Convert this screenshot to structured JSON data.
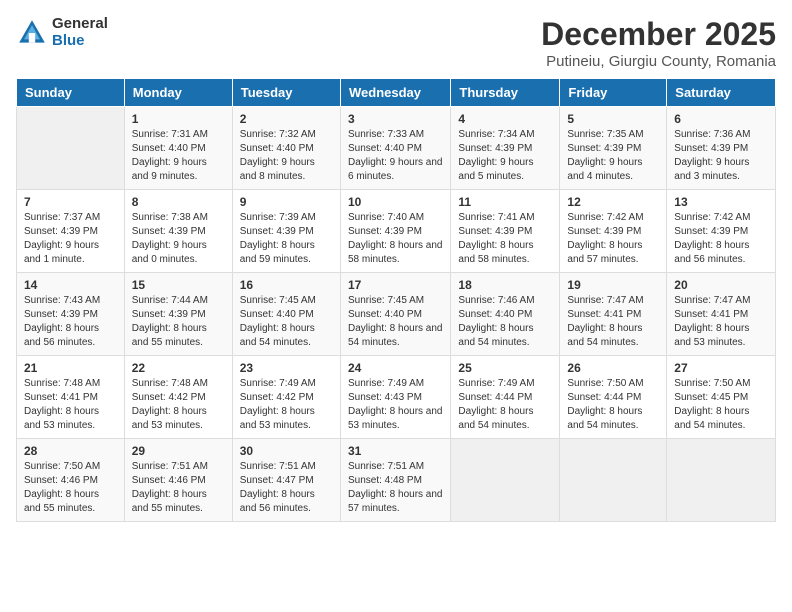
{
  "logo": {
    "general": "General",
    "blue": "Blue"
  },
  "title": "December 2025",
  "subtitle": "Putineiu, Giurgiu County, Romania",
  "days_header": [
    "Sunday",
    "Monday",
    "Tuesday",
    "Wednesday",
    "Thursday",
    "Friday",
    "Saturday"
  ],
  "weeks": [
    [
      {
        "day": "",
        "sunrise": "",
        "sunset": "",
        "daylight": ""
      },
      {
        "day": "1",
        "sunrise": "Sunrise: 7:31 AM",
        "sunset": "Sunset: 4:40 PM",
        "daylight": "Daylight: 9 hours and 9 minutes."
      },
      {
        "day": "2",
        "sunrise": "Sunrise: 7:32 AM",
        "sunset": "Sunset: 4:40 PM",
        "daylight": "Daylight: 9 hours and 8 minutes."
      },
      {
        "day": "3",
        "sunrise": "Sunrise: 7:33 AM",
        "sunset": "Sunset: 4:40 PM",
        "daylight": "Daylight: 9 hours and 6 minutes."
      },
      {
        "day": "4",
        "sunrise": "Sunrise: 7:34 AM",
        "sunset": "Sunset: 4:39 PM",
        "daylight": "Daylight: 9 hours and 5 minutes."
      },
      {
        "day": "5",
        "sunrise": "Sunrise: 7:35 AM",
        "sunset": "Sunset: 4:39 PM",
        "daylight": "Daylight: 9 hours and 4 minutes."
      },
      {
        "day": "6",
        "sunrise": "Sunrise: 7:36 AM",
        "sunset": "Sunset: 4:39 PM",
        "daylight": "Daylight: 9 hours and 3 minutes."
      }
    ],
    [
      {
        "day": "7",
        "sunrise": "Sunrise: 7:37 AM",
        "sunset": "Sunset: 4:39 PM",
        "daylight": "Daylight: 9 hours and 1 minute."
      },
      {
        "day": "8",
        "sunrise": "Sunrise: 7:38 AM",
        "sunset": "Sunset: 4:39 PM",
        "daylight": "Daylight: 9 hours and 0 minutes."
      },
      {
        "day": "9",
        "sunrise": "Sunrise: 7:39 AM",
        "sunset": "Sunset: 4:39 PM",
        "daylight": "Daylight: 8 hours and 59 minutes."
      },
      {
        "day": "10",
        "sunrise": "Sunrise: 7:40 AM",
        "sunset": "Sunset: 4:39 PM",
        "daylight": "Daylight: 8 hours and 58 minutes."
      },
      {
        "day": "11",
        "sunrise": "Sunrise: 7:41 AM",
        "sunset": "Sunset: 4:39 PM",
        "daylight": "Daylight: 8 hours and 58 minutes."
      },
      {
        "day": "12",
        "sunrise": "Sunrise: 7:42 AM",
        "sunset": "Sunset: 4:39 PM",
        "daylight": "Daylight: 8 hours and 57 minutes."
      },
      {
        "day": "13",
        "sunrise": "Sunrise: 7:42 AM",
        "sunset": "Sunset: 4:39 PM",
        "daylight": "Daylight: 8 hours and 56 minutes."
      }
    ],
    [
      {
        "day": "14",
        "sunrise": "Sunrise: 7:43 AM",
        "sunset": "Sunset: 4:39 PM",
        "daylight": "Daylight: 8 hours and 56 minutes."
      },
      {
        "day": "15",
        "sunrise": "Sunrise: 7:44 AM",
        "sunset": "Sunset: 4:39 PM",
        "daylight": "Daylight: 8 hours and 55 minutes."
      },
      {
        "day": "16",
        "sunrise": "Sunrise: 7:45 AM",
        "sunset": "Sunset: 4:40 PM",
        "daylight": "Daylight: 8 hours and 54 minutes."
      },
      {
        "day": "17",
        "sunrise": "Sunrise: 7:45 AM",
        "sunset": "Sunset: 4:40 PM",
        "daylight": "Daylight: 8 hours and 54 minutes."
      },
      {
        "day": "18",
        "sunrise": "Sunrise: 7:46 AM",
        "sunset": "Sunset: 4:40 PM",
        "daylight": "Daylight: 8 hours and 54 minutes."
      },
      {
        "day": "19",
        "sunrise": "Sunrise: 7:47 AM",
        "sunset": "Sunset: 4:41 PM",
        "daylight": "Daylight: 8 hours and 54 minutes."
      },
      {
        "day": "20",
        "sunrise": "Sunrise: 7:47 AM",
        "sunset": "Sunset: 4:41 PM",
        "daylight": "Daylight: 8 hours and 53 minutes."
      }
    ],
    [
      {
        "day": "21",
        "sunrise": "Sunrise: 7:48 AM",
        "sunset": "Sunset: 4:41 PM",
        "daylight": "Daylight: 8 hours and 53 minutes."
      },
      {
        "day": "22",
        "sunrise": "Sunrise: 7:48 AM",
        "sunset": "Sunset: 4:42 PM",
        "daylight": "Daylight: 8 hours and 53 minutes."
      },
      {
        "day": "23",
        "sunrise": "Sunrise: 7:49 AM",
        "sunset": "Sunset: 4:42 PM",
        "daylight": "Daylight: 8 hours and 53 minutes."
      },
      {
        "day": "24",
        "sunrise": "Sunrise: 7:49 AM",
        "sunset": "Sunset: 4:43 PM",
        "daylight": "Daylight: 8 hours and 53 minutes."
      },
      {
        "day": "25",
        "sunrise": "Sunrise: 7:49 AM",
        "sunset": "Sunset: 4:44 PM",
        "daylight": "Daylight: 8 hours and 54 minutes."
      },
      {
        "day": "26",
        "sunrise": "Sunrise: 7:50 AM",
        "sunset": "Sunset: 4:44 PM",
        "daylight": "Daylight: 8 hours and 54 minutes."
      },
      {
        "day": "27",
        "sunrise": "Sunrise: 7:50 AM",
        "sunset": "Sunset: 4:45 PM",
        "daylight": "Daylight: 8 hours and 54 minutes."
      }
    ],
    [
      {
        "day": "28",
        "sunrise": "Sunrise: 7:50 AM",
        "sunset": "Sunset: 4:46 PM",
        "daylight": "Daylight: 8 hours and 55 minutes."
      },
      {
        "day": "29",
        "sunrise": "Sunrise: 7:51 AM",
        "sunset": "Sunset: 4:46 PM",
        "daylight": "Daylight: 8 hours and 55 minutes."
      },
      {
        "day": "30",
        "sunrise": "Sunrise: 7:51 AM",
        "sunset": "Sunset: 4:47 PM",
        "daylight": "Daylight: 8 hours and 56 minutes."
      },
      {
        "day": "31",
        "sunrise": "Sunrise: 7:51 AM",
        "sunset": "Sunset: 4:48 PM",
        "daylight": "Daylight: 8 hours and 57 minutes."
      },
      {
        "day": "",
        "sunrise": "",
        "sunset": "",
        "daylight": ""
      },
      {
        "day": "",
        "sunrise": "",
        "sunset": "",
        "daylight": ""
      },
      {
        "day": "",
        "sunrise": "",
        "sunset": "",
        "daylight": ""
      }
    ]
  ]
}
